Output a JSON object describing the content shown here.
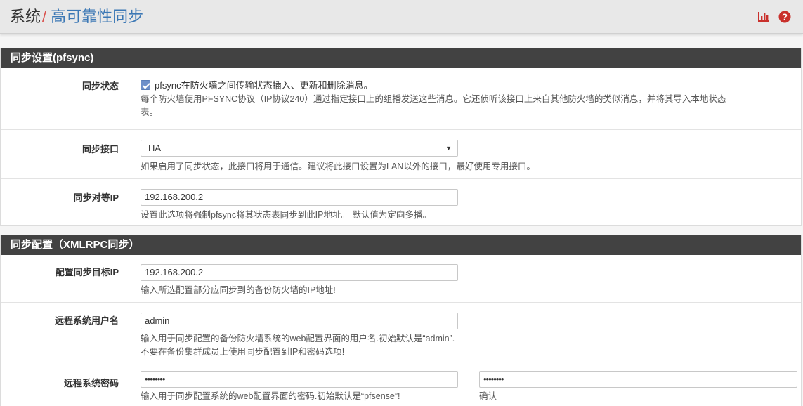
{
  "header": {
    "crumb_root": "系统",
    "crumb_sep": "/",
    "crumb_current": "高可靠性同步",
    "icons": [
      "bar-chart-icon",
      "help-icon"
    ],
    "accent": "#c9302c"
  },
  "pfsync": {
    "title": "同步设置(pfsync)",
    "sync_state": {
      "label": "同步状态",
      "checked": true,
      "checkbox_text": "pfsync在防火墙之间传输状态插入、更新和删除消息。",
      "help_line1": "每个防火墙使用PFSYNC协议（IP协议240）通过指定接口上的组播发送这些消息。它还侦听该接口上来自其他防火墙的类似消息，并将其导入本地状态",
      "help_line2": "表。"
    },
    "sync_interface": {
      "label": "同步接口",
      "value": "HA",
      "help": "如果启用了同步状态，此接口将用于通信。建议将此接口设置为LAN以外的接口，最好使用专用接口。"
    },
    "sync_peer_ip": {
      "label": "同步对等IP",
      "value": "192.168.200.2",
      "help": "设置此选项将强制pfsync将其状态表同步到此IP地址。 默认值为定向多播。"
    }
  },
  "xmlrpc": {
    "title": "同步配置（XMLRPC同步）",
    "target_ip": {
      "label": "配置同步目标IP",
      "value": "192.168.200.2",
      "help": "输入所选配置部分应同步到的备份防火墙的IP地址!"
    },
    "remote_user": {
      "label": "远程系统用户名",
      "value": "admin",
      "help_line1": "输入用于同步配置的备份防火墙系统的web配置界面的用户名.初始默认是“admin”.",
      "help_line2": "不要在备份集群成员上使用同步配置到IP和密码选项!"
    },
    "remote_password": {
      "label": "远程系统密码",
      "value": "••••••••",
      "confirm_value": "••••••••",
      "help": "输入用于同步配置系统的web配置界面的密码.初始默认是“pfsense”!",
      "confirm_label": "确认"
    }
  }
}
